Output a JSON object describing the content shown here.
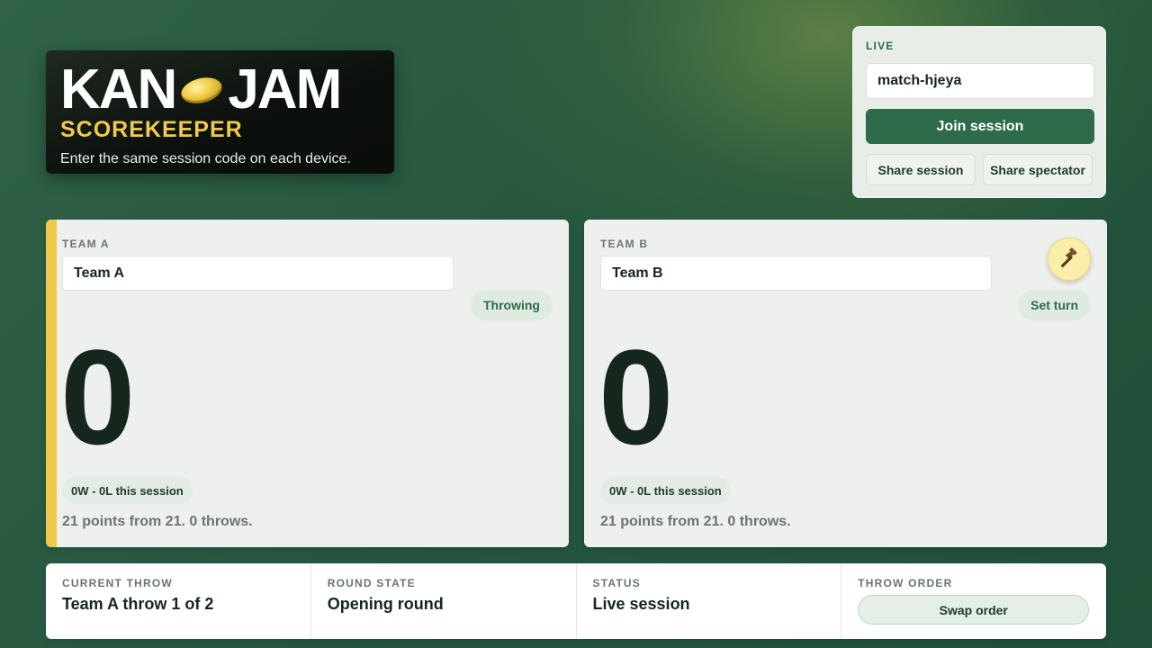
{
  "brand": {
    "title_left": "KAN",
    "title_right": "JAM",
    "subtitle": "SCOREKEEPER",
    "description": "Enter the same session code on each device."
  },
  "live": {
    "label": "LIVE",
    "session_code": "match-hjeya",
    "join_label": "Join session",
    "share_session_label": "Share session",
    "share_spectator_label": "Share spectator"
  },
  "teams": [
    {
      "label": "TEAM A",
      "name": "Team A",
      "turn_label": "Throwing",
      "score": "0",
      "record": "0W - 0L this session",
      "points_text": "21 points from 21. 0 throws."
    },
    {
      "label": "TEAM B",
      "name": "Team B",
      "turn_label": "Set turn",
      "score": "0",
      "record": "0W - 0L this session",
      "points_text": "21 points from 21. 0 throws."
    }
  ],
  "status": {
    "current_throw_label": "CURRENT THROW",
    "current_throw_value": "Team A throw 1 of 2",
    "round_state_label": "ROUND STATE",
    "round_state_value": "Opening round",
    "status_label": "STATUS",
    "status_value": "Live session",
    "throw_order_label": "THROW ORDER",
    "swap_label": "Swap order"
  },
  "colors": {
    "accent_green": "#2e6b4a",
    "active_team_bar": "#f1c94a",
    "brand_yellow": "#f2c94c"
  },
  "icons": {
    "logo_disc": "frisbee-icon",
    "hammer": "hammer-icon"
  }
}
